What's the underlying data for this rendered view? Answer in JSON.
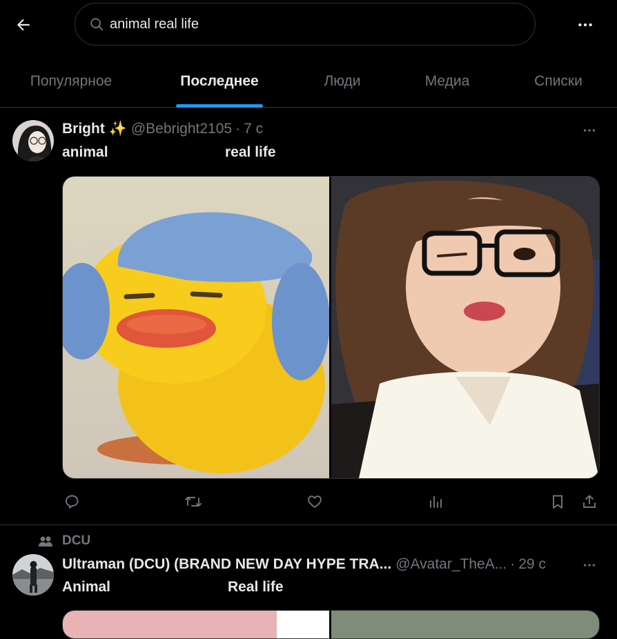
{
  "search": {
    "value": "animal real life"
  },
  "tabs": [
    {
      "label": "Популярное"
    },
    {
      "label": "Последнее"
    },
    {
      "label": "Люди"
    },
    {
      "label": "Медиа"
    },
    {
      "label": "Списки"
    }
  ],
  "active_tab": "Последнее",
  "posts": [
    {
      "name": "Bright ✨",
      "handle": "@Bebright2105",
      "time": "7 с",
      "text_left": "animal",
      "text_right": "real life"
    },
    {
      "context": "DCU",
      "name": "Ultraman (DCU) (BRAND NEW DAY HYPE TRA...",
      "handle": "@Avatar_TheA...",
      "time": "29 с",
      "text_left": "Animal",
      "text_right": "Real life"
    }
  ],
  "colors": {
    "accent": "#1d9bf0",
    "muted": "#71767b",
    "text": "#e7e9ea",
    "border": "#2f3336",
    "background": "#000000"
  },
  "icons": [
    "arrow-left-icon",
    "search-icon",
    "more-horizontal-icon",
    "reply-icon",
    "retweet-icon",
    "like-icon",
    "views-icon",
    "bookmark-icon",
    "share-icon",
    "community-icon"
  ]
}
